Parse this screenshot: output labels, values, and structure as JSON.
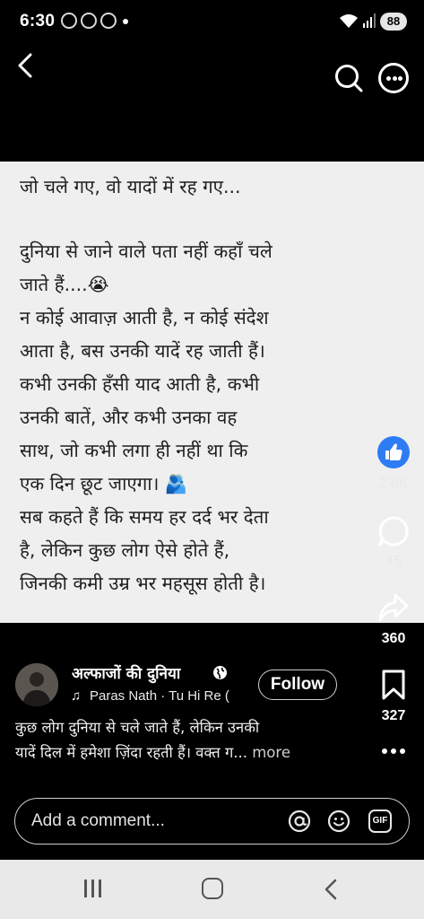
{
  "status_bar": {
    "time": "6:30",
    "battery": "88",
    "icons": [
      "messenger-icon",
      "chrome-icon",
      "media-icon",
      "wifi-icon",
      "signal-icon"
    ]
  },
  "post": {
    "text_lines": [
      "जो चले गए, वो यादों में रह गए...",
      "",
      "दुनिया से जाने वाले पता नहीं कहाँ चले",
      "जाते हैं....😭",
      "न कोई आवाज़ आती है, न कोई संदेश",
      "आता है, बस उनकी यादें रह जाती हैं।",
      "कभी उनकी हँसी याद आती है, कभी",
      "उनकी बातें, और कभी उनका वह",
      "साथ, जो कभी लगा ही नहीं था कि",
      "एक दिन छूट जाएगा। 🫂",
      "सब कहते हैं कि समय हर दर्द भर देता",
      "है, लेकिन कुछ लोग ऐसे होते हैं,",
      "जिनकी कमी उम्र भर महसूस होती है।"
    ]
  },
  "actions": {
    "likes": "2.8K",
    "comments": "45",
    "shares": "360",
    "saves": "327"
  },
  "author": {
    "name": "अल्फाजों की दुनिया",
    "music": "Paras Nath · Tu Hi Re (",
    "follow_label": "Follow"
  },
  "caption": {
    "line1": "कुछ लोग दुनिया से चले जाते हैं, लेकिन उनकी",
    "line2": "यादें दिल में हमेशा ज़िंदा रहती हैं। वक्त ग...",
    "more": "more"
  },
  "comment_box": {
    "placeholder": "Add a comment..."
  },
  "colors": {
    "background": "#000000",
    "post_bg": "#efefef",
    "like_blue": "#2e7cf3",
    "nav_bar": "#e9e9e9"
  }
}
